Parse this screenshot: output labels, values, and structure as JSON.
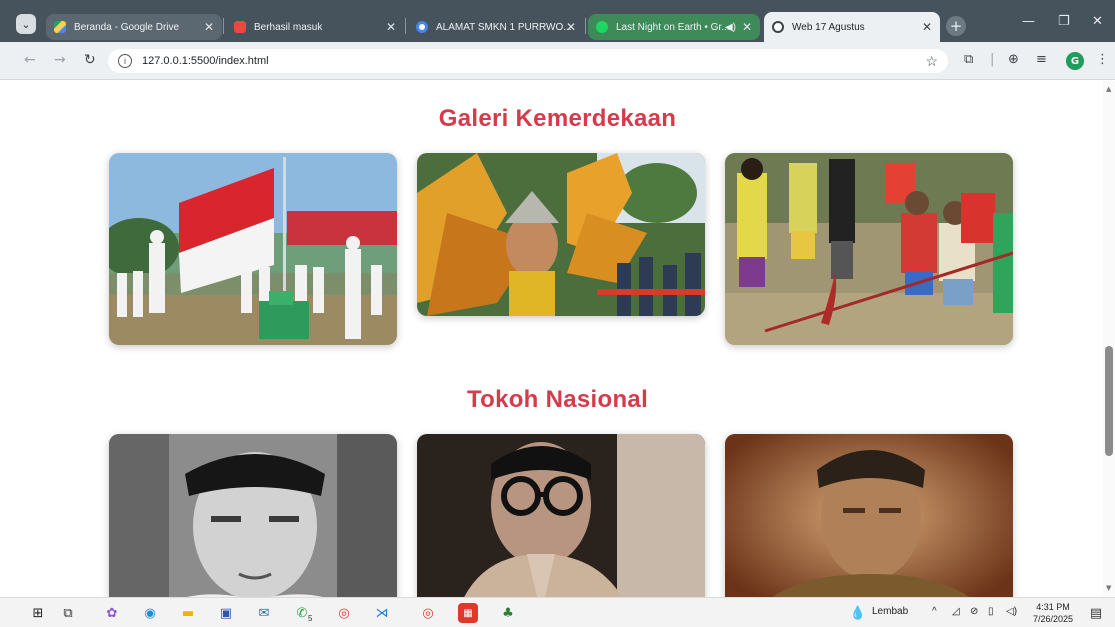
{
  "overlay_text": {
    "left": "",
    "right": ""
  },
  "browser": {
    "tabs": [
      {
        "label": "Beranda - Google Drive",
        "favicon": "google-drive-icon"
      },
      {
        "label": "Berhasil masuk",
        "favicon": "gmail-icon"
      },
      {
        "label": "ALAMAT SMKN 1 PURRWO...",
        "favicon": "google-icon"
      },
      {
        "label": "Last Night on Earth • Gr...",
        "favicon": "spotify-icon"
      },
      {
        "label": "Web 17 Agustus",
        "favicon": "globe-icon",
        "active": true
      }
    ],
    "url": "127.0.0.1:5500/index.html"
  },
  "profile_initial": "G",
  "page": {
    "gallery_title": "Galeri Kemerdekaan",
    "gallery_images": [
      {
        "alt": "flag-ceremony"
      },
      {
        "alt": "carnival-costume"
      },
      {
        "alt": "tug-of-war"
      }
    ],
    "heroes_title": "Tokoh Nasional",
    "hero_images": [
      {
        "alt": "soekarno-portrait"
      },
      {
        "alt": "hatta-portrait"
      },
      {
        "alt": "sudirman-portrait"
      }
    ]
  },
  "taskbar": {
    "weather": "Lembab",
    "time": "4:31 PM",
    "date": "7/26/2025",
    "whatsapp_badge": "5"
  },
  "colors": {
    "section_title": "#d63a4b",
    "tab_bar": "#46525c",
    "toolbar": "#edf0f2"
  }
}
